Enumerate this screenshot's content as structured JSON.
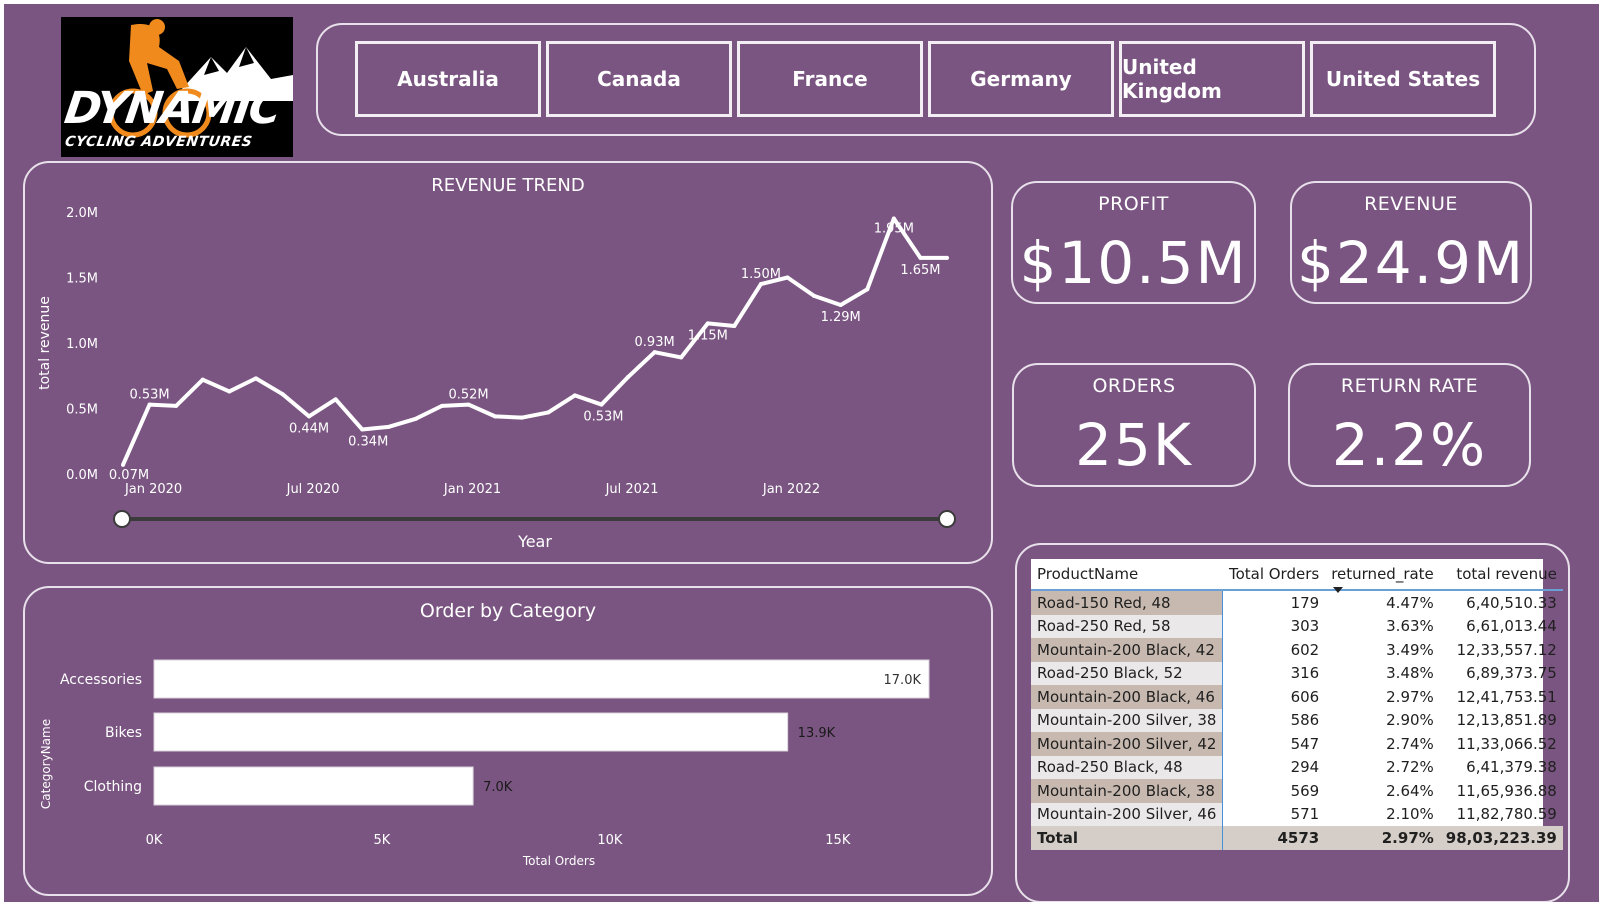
{
  "logo": {
    "brand": "DYNAMIC",
    "tagline": "CYCLING ADVENTURES"
  },
  "slicer": {
    "countries": [
      "Australia",
      "Canada",
      "France",
      "Germany",
      "United Kingdom",
      "United States"
    ]
  },
  "kpis": {
    "profit": {
      "title": "PROFIT",
      "value": "$10.5M"
    },
    "revenue": {
      "title": "REVENUE",
      "value": "$24.9M"
    },
    "orders": {
      "title": "ORDERS",
      "value": "25K"
    },
    "return_rate": {
      "title": "RETURN RATE",
      "value": "2.2%"
    }
  },
  "revenue_trend": {
    "title": "REVENUE TREND",
    "slider_label": "Year"
  },
  "order_by_category": {
    "title": "Order by Category"
  },
  "product_table": {
    "columns": [
      "ProductName",
      "Total Orders",
      "returned_rate",
      "total revenue"
    ],
    "rows": [
      [
        "Road-150 Red, 48",
        "179",
        "4.47%",
        "6,40,510.33"
      ],
      [
        "Road-250 Red, 58",
        "303",
        "3.63%",
        "6,61,013.44"
      ],
      [
        "Mountain-200 Black, 42",
        "602",
        "3.49%",
        "12,33,557.12"
      ],
      [
        "Road-250 Black, 52",
        "316",
        "3.48%",
        "6,89,373.75"
      ],
      [
        "Mountain-200 Black, 46",
        "606",
        "2.97%",
        "12,41,753.51"
      ],
      [
        "Mountain-200 Silver, 38",
        "586",
        "2.90%",
        "12,13,851.89"
      ],
      [
        "Mountain-200 Silver, 42",
        "547",
        "2.74%",
        "11,33,066.52"
      ],
      [
        "Road-250 Black, 48",
        "294",
        "2.72%",
        "6,41,379.38"
      ],
      [
        "Mountain-200 Black, 38",
        "569",
        "2.64%",
        "11,65,936.88"
      ],
      [
        "Mountain-200 Silver, 46",
        "571",
        "2.10%",
        "11,82,780.59"
      ]
    ],
    "total": [
      "Total",
      "4573",
      "2.97%",
      "98,03,223.39"
    ]
  },
  "colors": {
    "background": "#7a5581",
    "line": "#ffffff",
    "bar": "#ffffff",
    "table_highlight": "#c7b9af"
  },
  "chart_data": [
    {
      "type": "line",
      "title": "REVENUE TREND",
      "xlabel": "",
      "ylabel": "total revenue",
      "ylim": [
        0,
        2000000
      ],
      "y_ticks": [
        0,
        500000,
        1000000,
        1500000,
        2000000
      ],
      "y_tick_labels": [
        "0.0M",
        "0.5M",
        "1.0M",
        "1.5M",
        "2.0M"
      ],
      "x_ticks": [
        "2020-01",
        "2020-07",
        "2021-01",
        "2021-07",
        "2022-01"
      ],
      "x_tick_labels": [
        "Jan 2020",
        "Jul 2020",
        "Jan 2021",
        "Jul 2021",
        "Jan 2022"
      ],
      "x": [
        "2019-12",
        "2020-01",
        "2020-02",
        "2020-03",
        "2020-04",
        "2020-05",
        "2020-06",
        "2020-07",
        "2020-08",
        "2020-09",
        "2020-10",
        "2020-11",
        "2020-12",
        "2021-01",
        "2021-02",
        "2021-03",
        "2021-04",
        "2021-05",
        "2021-06",
        "2021-07",
        "2021-08",
        "2021-09",
        "2021-10",
        "2021-11",
        "2021-12",
        "2022-01",
        "2022-02",
        "2022-03",
        "2022-04",
        "2022-05",
        "2022-06",
        "2022-07"
      ],
      "values": [
        70000,
        530000,
        520000,
        720000,
        630000,
        730000,
        610000,
        440000,
        570000,
        340000,
        360000,
        420000,
        520000,
        530000,
        440000,
        430000,
        470000,
        600000,
        530000,
        740000,
        930000,
        890000,
        1150000,
        1130000,
        1450000,
        1500000,
        1360000,
        1290000,
        1410000,
        1950000,
        1650000,
        1650000
      ],
      "data_labels": [
        {
          "x": "2019-12",
          "text": "0.07M"
        },
        {
          "x": "2020-01",
          "text": "0.53M"
        },
        {
          "x": "2020-07",
          "text": "0.44M"
        },
        {
          "x": "2020-09",
          "text": "0.34M"
        },
        {
          "x": "2021-01",
          "text": "0.52M"
        },
        {
          "x": "2021-06",
          "text": "0.53M"
        },
        {
          "x": "2021-08",
          "text": "0.93M"
        },
        {
          "x": "2021-10",
          "text": "1.15M"
        },
        {
          "x": "2021-12",
          "text": "1.50M"
        },
        {
          "x": "2022-03",
          "text": "1.29M"
        },
        {
          "x": "2022-05",
          "text": "1.95M"
        },
        {
          "x": "2022-06",
          "text": "1.65M"
        }
      ]
    },
    {
      "type": "bar",
      "orientation": "horizontal",
      "title": "Order by Category",
      "xlabel": "Total Orders",
      "ylabel": "CategoryName",
      "categories": [
        "Accessories",
        "Bikes",
        "Clothing"
      ],
      "values": [
        17000,
        13900,
        7000
      ],
      "value_labels": [
        "17.0K",
        "13.9K",
        "7.0K"
      ],
      "xlim": [
        0,
        17000
      ],
      "x_ticks": [
        0,
        5000,
        10000,
        15000
      ],
      "x_tick_labels": [
        "0K",
        "5K",
        "10K",
        "15K"
      ]
    }
  ]
}
